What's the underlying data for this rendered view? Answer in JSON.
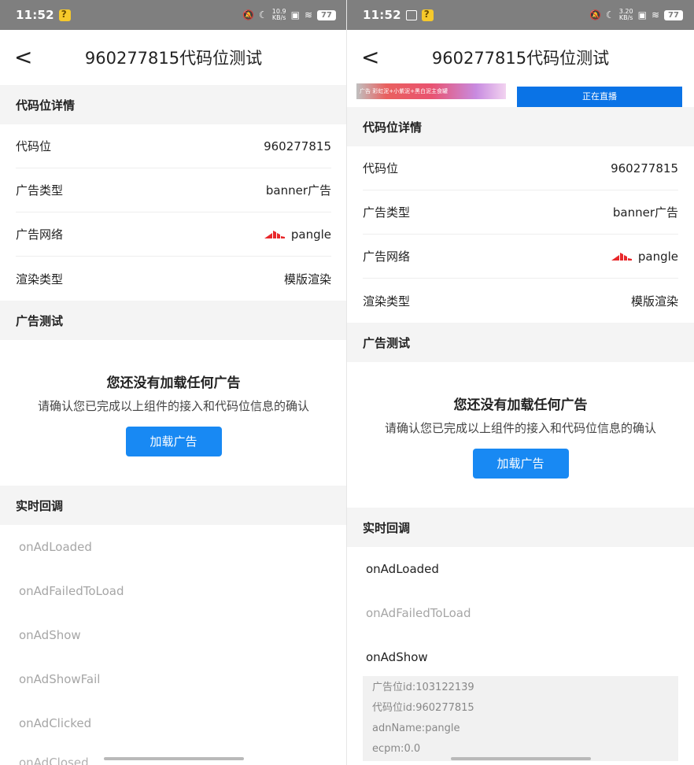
{
  "status": {
    "left_time": "11:52",
    "right_time": "11:52",
    "left_speed_top": "10.9",
    "left_speed_bottom": "KB/s",
    "right_speed_top": "3.20",
    "right_speed_bottom": "KB/s",
    "battery": "77"
  },
  "header": {
    "back_glyph": "<",
    "title": "960277815代码位测试"
  },
  "ad_banner": {
    "left_text": "广告 彩虹泥+小紫泥+黑白泥主食罐",
    "right_text": "正在直播"
  },
  "details": {
    "section_title": "代码位详情",
    "rows": [
      {
        "label": "代码位",
        "value": "960277815"
      },
      {
        "label": "广告类型",
        "value": "banner广告"
      },
      {
        "label": "广告网络",
        "value": "pangle"
      },
      {
        "label": "渲染类型",
        "value": "模版渲染"
      }
    ]
  },
  "test": {
    "section_title": "广告测试",
    "empty_title": "您还没有加载任何广告",
    "empty_sub": "请确认您已完成以上组件的接入和代码位信息的确认",
    "load_button": "加载广告"
  },
  "callbacks": {
    "section_title": "实时回调",
    "items": [
      "onAdLoaded",
      "onAdFailedToLoad",
      "onAdShow",
      "onAdShowFail",
      "onAdClicked"
    ],
    "cut_item": "onAdClosed",
    "show_details": [
      "广告位id:103122139",
      "代码位id:960277815",
      "adnName:pangle",
      "ecpm:0.0"
    ]
  },
  "colors": {
    "accent": "#1889f3",
    "status_bar": "#7f7f7f",
    "section_bg": "#f4f4f4",
    "pangle_red": "#e8282b"
  },
  "icons": {
    "status_left": [
      "app-yellow-icon"
    ],
    "status_right": [
      "bell-off-icon",
      "moon-icon",
      "sim-icon",
      "wifi-icon",
      "battery-icon"
    ],
    "back": "back-arrow-icon",
    "network": "pangle-logo-icon"
  }
}
